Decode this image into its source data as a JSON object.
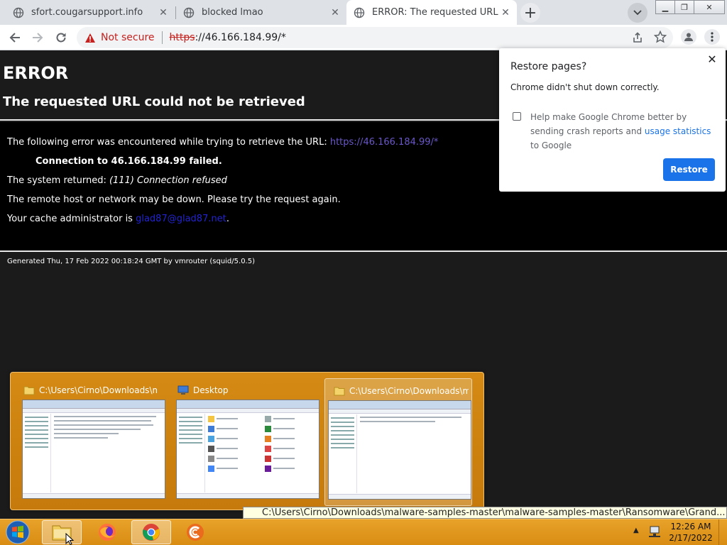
{
  "browser": {
    "tabs": [
      {
        "title": "sfort.cougarsupport.info",
        "active": false
      },
      {
        "title": "blocked lmao",
        "active": false
      },
      {
        "title": "ERROR: The requested URL could not be retrieved",
        "active": true
      }
    ],
    "address": {
      "security_label": "Not secure",
      "scheme": "https",
      "rest": "://46.166.184.99/*"
    },
    "icons": [
      "back-icon",
      "forward-icon",
      "reload-icon",
      "share-icon",
      "star-icon",
      "profile-icon",
      "menu-icon"
    ]
  },
  "error_page": {
    "heading": "ERROR",
    "subheading": "The requested URL could not be retrieved",
    "line1_prefix": "The following error was encountered while trying to retrieve the URL: ",
    "line1_link": "https://46.166.184.99/*",
    "connection_failed": "Connection to 46.166.184.99 failed.",
    "system_returned_prefix": "The system returned: ",
    "system_returned_value": "(111) Connection refused",
    "remote_down": "The remote host or network may be down. Please try the request again.",
    "cache_admin_prefix": "Your cache administrator is ",
    "cache_admin_email": "glad87@glad87.net",
    "cache_admin_suffix": ".",
    "footer": "Generated Thu, 17 Feb 2022 00:18:24 GMT by vmrouter (squid/5.0.5)"
  },
  "restore_popup": {
    "title": "Restore pages?",
    "message": "Chrome didn't shut down correctly.",
    "checkbox_prefix": "Help make Google Chrome better by sending crash reports and ",
    "checkbox_link": "usage statistics",
    "checkbox_suffix": " to Google",
    "button": "Restore"
  },
  "taskbar_thumbnails": [
    {
      "title": "C:\\Users\\Cirno\\Downloads\\mal...",
      "icon": "folder-icon",
      "selected": false
    },
    {
      "title": "Desktop",
      "icon": "desktop-icon",
      "selected": false
    },
    {
      "title": "C:\\Users\\Cirno\\Downloads\\mal...",
      "icon": "folder-icon",
      "selected": true
    }
  ],
  "tooltip_path": "C:\\Users\\Cirno\\Downloads\\malware-samples-master\\malware-samples-master\\Ransomware\\Grand...",
  "taskbar": {
    "apps": [
      "explorer-icon",
      "firefox-icon",
      "chrome-icon",
      "ccleaner-icon"
    ],
    "time": "12:26 AM",
    "date": "2/17/2022"
  },
  "colors": {
    "accent": "#1a73e8",
    "taskbar": "#e09a1e",
    "not_secure": "#c5221f"
  }
}
